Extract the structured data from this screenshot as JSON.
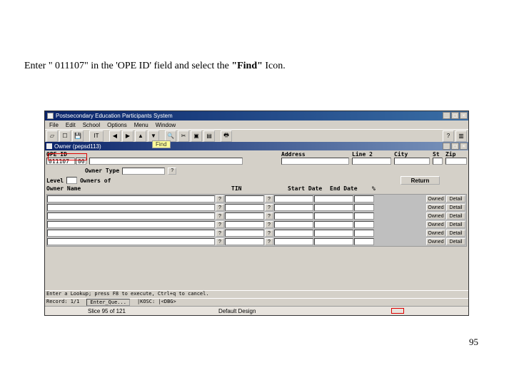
{
  "instruction": {
    "prefix": "Enter \" 011107\" in the 'OPE ID' field and select the ",
    "bold": "\"Find\"",
    "suffix": " Icon."
  },
  "outer_window": {
    "title": "Postsecondary Education Participants System",
    "win_min": "_",
    "win_max": "□",
    "win_close": "×"
  },
  "menu": {
    "items": [
      "File",
      "Edit",
      "School",
      "Options",
      "Menu",
      "Window"
    ]
  },
  "toolbar": {
    "it_label": "IT",
    "find_callout": "Find"
  },
  "inner_window": {
    "title": "Owner (pepsd113)"
  },
  "form": {
    "ope_id_label": "OPE ID",
    "ope_id_value": "011107",
    "ope_id_suffix": "00",
    "address_label": "Address",
    "line2_label": "Line 2",
    "city_label": "City",
    "st_label": "St",
    "zip_label": "Zip",
    "owner_type_label": "Owner Type",
    "level_label": "Level",
    "owners_of_label": "Owners of",
    "return_label": "Return",
    "owner_name_label": "Owner Name",
    "tin_label": "TIN",
    "start_date_label": "Start Date",
    "end_date_label": "End Date",
    "pct_label": "%",
    "owned_label": "Owned",
    "detail_label": "Detail"
  },
  "grid": {
    "rows": 6
  },
  "status": {
    "line1": "Enter a Lookup; press F8 to execute, Ctrl+q to cancel.",
    "record": "Record: 1/1",
    "enter": "Enter_Que...",
    "kosc": "|KOSC: |<DBG>"
  },
  "slice": {
    "text": "Slice 95 of 121",
    "design": "Default Design"
  },
  "page_number": "95"
}
